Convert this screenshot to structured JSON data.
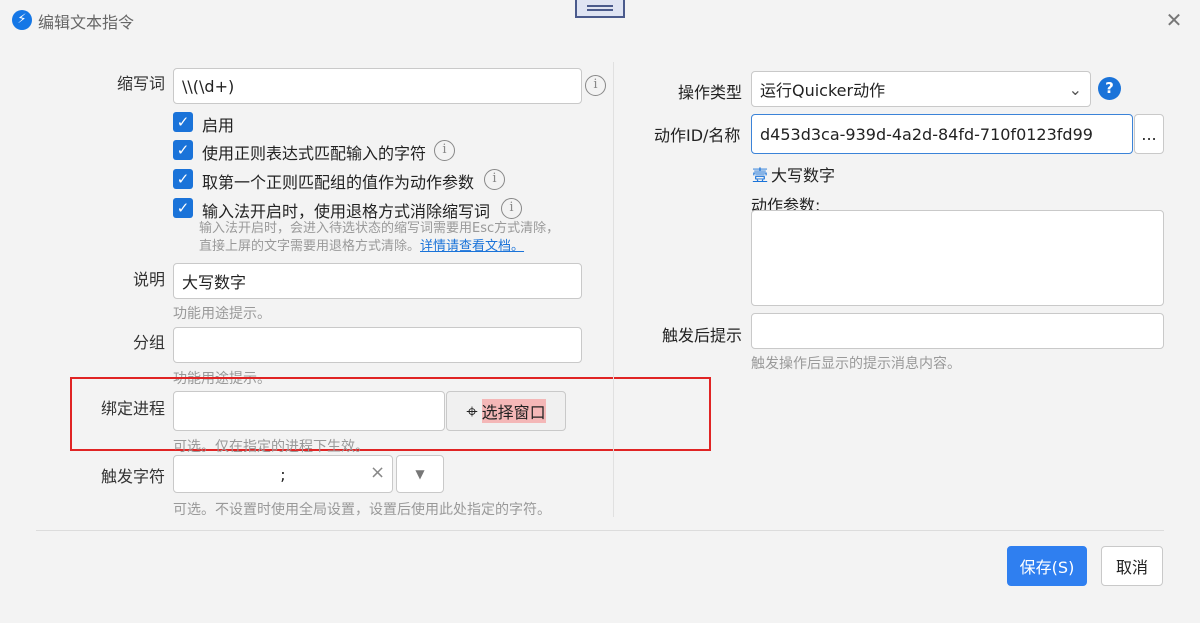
{
  "window": {
    "title": "编辑文本指令",
    "app_icon": "quicker-bolt-icon",
    "close_icon": "✕"
  },
  "left": {
    "abbr": {
      "label": "缩写词",
      "value": "\\\\(\\d+)"
    },
    "checkboxes": [
      {
        "label": "启用",
        "checked": true
      },
      {
        "label": "使用正则表达式匹配输入的字符",
        "checked": true
      },
      {
        "label": "取第一个正则匹配组的值作为动作参数",
        "checked": true
      },
      {
        "label": "输入法开启时，使用退格方式消除缩写词",
        "checked": true
      }
    ],
    "ime_note_line1": "输入法开启时，会进入待选状态的缩写词需要用Esc方式清除，",
    "ime_note_line2": "直接上屏的文字需要用退格方式清除。",
    "ime_note_link": "详情请查看文档。",
    "desc": {
      "label": "说明",
      "value": "大写数字",
      "hint": "功能用途提示。"
    },
    "group": {
      "label": "分组",
      "value": "",
      "hint": "功能用途提示。"
    },
    "process": {
      "label": "绑定进程",
      "value": "",
      "button": "选择窗口",
      "hint": "可选。仅在指定的进程下生效。"
    },
    "trigger": {
      "label": "触发字符",
      "value": ";",
      "clear": "×",
      "dropdown": "▼",
      "hint": "可选。不设置时使用全局设置，设置后使用此处指定的字符。"
    }
  },
  "right": {
    "action_type": {
      "label": "操作类型",
      "value": "运行Quicker动作",
      "help": "?"
    },
    "action_id": {
      "label": "动作ID/名称",
      "value": "d453d3ca-939d-4a2d-84fd-710f0123fd99",
      "browse": "..."
    },
    "action_name_icon": "壹",
    "action_name": "大写数字",
    "params": {
      "label": "动作参数:",
      "value": ""
    },
    "after_hint": {
      "label": "触发后提示",
      "value": "",
      "hint": "触发操作后显示的提示消息内容。"
    }
  },
  "footer": {
    "save": "保存(S)",
    "cancel": "取消"
  },
  "colors": {
    "accent": "#1a73d9",
    "save_bg": "#2f7ff0",
    "highlight": "#e02424"
  }
}
